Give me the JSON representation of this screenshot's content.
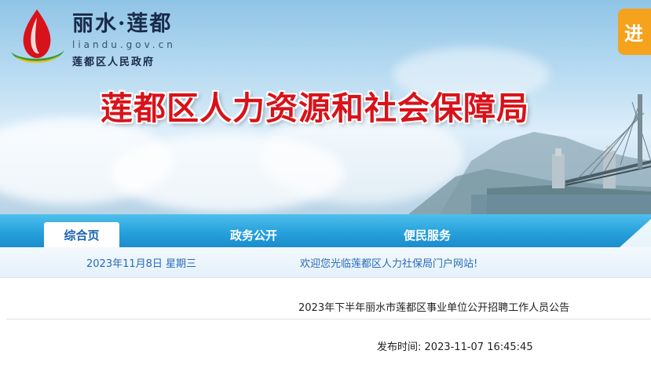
{
  "header": {
    "site_name": "丽水·莲都",
    "site_domain": "liandu.gov.cn",
    "site_subtitle": "莲都区人民政府",
    "main_title": "莲都区人力资源和社会保障局",
    "enter_label": "进"
  },
  "nav": {
    "tabs": [
      {
        "label": "综合页",
        "active": true
      },
      {
        "label": "政务公开",
        "active": false
      },
      {
        "label": "便民服务",
        "active": false
      }
    ]
  },
  "info_bar": {
    "date": "2023年11月8日 星期三",
    "welcome": "欢迎您光临莲都区人力社保局门户网站!"
  },
  "article": {
    "title": "2023年下半年丽水市莲都区事业单位公开招聘工作人员公告",
    "publish_label": "发布时间:",
    "publish_time": "2023-11-07 16:45:45"
  },
  "colors": {
    "title_red": "#d8121a",
    "nav_blue": "#27a1dc",
    "enter_orange": "#f5a21d",
    "link_blue": "#2a6ab8"
  }
}
